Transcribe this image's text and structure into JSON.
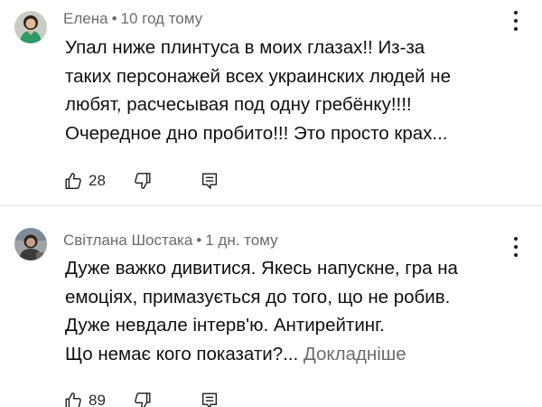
{
  "comments": [
    {
      "author": "Елена",
      "separator": "•",
      "time": "10 год тому",
      "lines": [
        "Упал ниже плинтуса в моих глазах!! Из-за",
        "таких персонажей всех украинских людей не",
        "любят, расчесывая под одну гребёнку!!!!",
        "Очередное дно пробито!!! Это просто крах..."
      ],
      "more_label": "",
      "likes": "28",
      "avatar_icon": "user-avatar-woman-green",
      "icons": [
        "thumb-up-icon",
        "thumb-down-icon",
        "reply-icon",
        "more-vert-icon"
      ]
    },
    {
      "author": "Світлана Шостака",
      "separator": "•",
      "time": "1 дн. тому",
      "lines": [
        "Дуже важко дивитися. Якесь напускне, гра на",
        "емоціях, примазується до того, що не робив.",
        "Дуже невдале інтерв'ю. Антирейтинг.",
        "Що немає кого показати?..."
      ],
      "more_label": "Докладніше",
      "likes": "89",
      "avatar_icon": "user-avatar-person-dark",
      "icons": [
        "thumb-up-icon",
        "thumb-down-icon",
        "reply-icon",
        "more-vert-icon"
      ]
    }
  ],
  "colors": {
    "text": "#0f0f0f",
    "meta": "#6b6b6b",
    "divider": "#e3e3e3",
    "background": "#ffffff"
  }
}
